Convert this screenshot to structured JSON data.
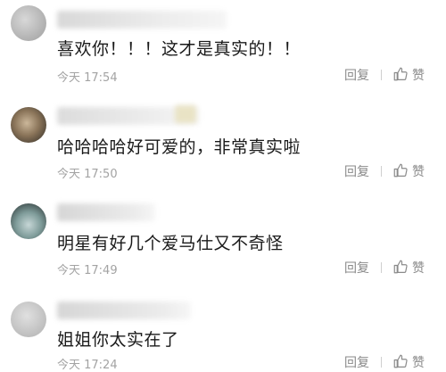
{
  "comments": [
    {
      "text": "喜欢你！！！这才是真实的！！",
      "time": "今天 17:54",
      "reply": "回复",
      "like": "赞"
    },
    {
      "text": "哈哈哈哈好可爱的，非常真实啦",
      "time": "今天 17:50",
      "reply": "回复",
      "like": "赞"
    },
    {
      "text": "明星有好几个爱马仕又不奇怪",
      "time": "今天 17:49",
      "reply": "回复",
      "like": "赞"
    },
    {
      "text": "姐姐你太实在了",
      "time": "今天 17:24",
      "reply": "回复",
      "like": "赞"
    }
  ],
  "colors": {
    "text": "#1a1a1a",
    "meta": "#a3a3a3",
    "action": "#8a8a8a"
  },
  "icons": {
    "like": "thumbs-up-icon"
  }
}
